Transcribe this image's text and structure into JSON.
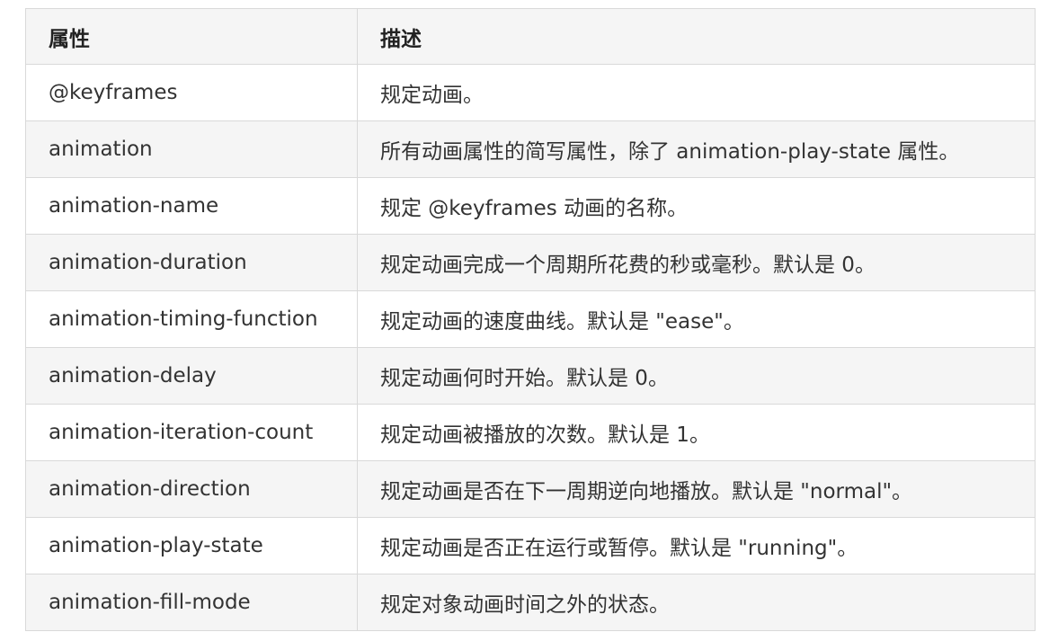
{
  "table": {
    "headers": {
      "property": "属性",
      "description": "描述"
    },
    "rows": [
      {
        "property": "@keyframes",
        "description": "规定动画。"
      },
      {
        "property": "animation",
        "description": "所有动画属性的简写属性，除了 animation-play-state 属性。"
      },
      {
        "property": "animation-name",
        "description": "规定 @keyframes 动画的名称。"
      },
      {
        "property": "animation-duration",
        "description": "规定动画完成一个周期所花费的秒或毫秒。默认是 0。"
      },
      {
        "property": "animation-timing-function",
        "description": "规定动画的速度曲线。默认是 \"ease\"。"
      },
      {
        "property": "animation-delay",
        "description": "规定动画何时开始。默认是 0。"
      },
      {
        "property": "animation-iteration-count",
        "description": "规定动画被播放的次数。默认是 1。"
      },
      {
        "property": "animation-direction",
        "description": "规定动画是否在下一周期逆向地播放。默认是 \"normal\"。"
      },
      {
        "property": "animation-play-state",
        "description": "规定动画是否正在运行或暂停。默认是 \"running\"。"
      },
      {
        "property": "animation-fill-mode",
        "description": "规定对象动画时间之外的状态。"
      }
    ]
  }
}
